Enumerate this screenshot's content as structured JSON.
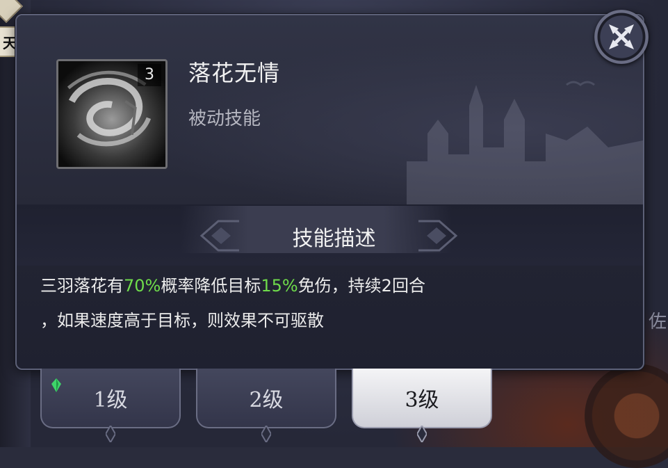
{
  "background": {
    "corner_badge_text": "天",
    "right_partial_text": "佐"
  },
  "dialog": {
    "skill_icon": {
      "icon": "swirl-petal-icon",
      "level_badge": "3"
    },
    "skill_name": "落花无情",
    "skill_type": "被动技能",
    "close_icon": "close-x-icon",
    "section_title": "技能描述",
    "description": {
      "line1": [
        {
          "text": "三羽落花有",
          "highlight": false
        },
        {
          "text": "70%",
          "highlight": true
        },
        {
          "text": "概率降低目标",
          "highlight": false
        },
        {
          "text": "15%",
          "highlight": true
        },
        {
          "text": "免伤，持续2回合",
          "highlight": false
        }
      ],
      "line2": "，如果速度高于目标，则效果不可驱散"
    }
  },
  "level_tabs": [
    {
      "label": "1级",
      "active": false,
      "gem": "green-gem-icon"
    },
    {
      "label": "2级",
      "active": false
    },
    {
      "label": "3级",
      "active": true
    }
  ],
  "colors": {
    "highlight": "#6fdc4b",
    "dialog_bg": "#232533",
    "active_tab": "#f4f4f6"
  }
}
